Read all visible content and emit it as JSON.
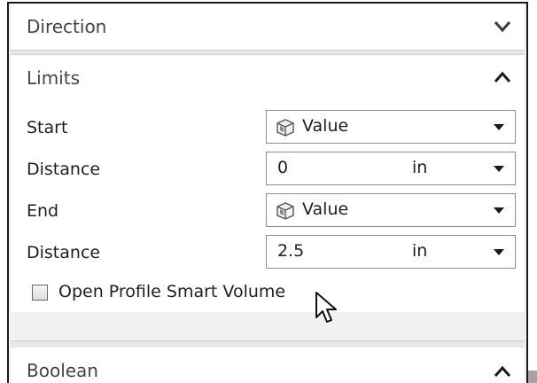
{
  "sections": {
    "direction": {
      "title": "Direction",
      "expanded": false
    },
    "limits": {
      "title": "Limits",
      "expanded": true,
      "rows": [
        {
          "label": "Start",
          "value": "Value",
          "icon": "cube-icon",
          "unit": ""
        },
        {
          "label": "Distance",
          "value": "0",
          "icon": "",
          "unit": "in"
        },
        {
          "label": "End",
          "value": "Value",
          "icon": "cube-icon",
          "unit": ""
        },
        {
          "label": "Distance",
          "value": "2.5",
          "icon": "",
          "unit": "in"
        }
      ],
      "checkbox": {
        "label": "Open Profile Smart Volume",
        "checked": false
      }
    },
    "boolean": {
      "title": "Boolean",
      "expanded": true
    }
  },
  "icons": {
    "collapse": "chevron-up-icon",
    "expand": "chevron-down-icon",
    "dropdown": "caret-down-icon",
    "cursor": "mouse-pointer-icon"
  },
  "colors": {
    "header_text": "#444444",
    "separator": "#e7e7e7",
    "border": "#8c8c8c"
  }
}
